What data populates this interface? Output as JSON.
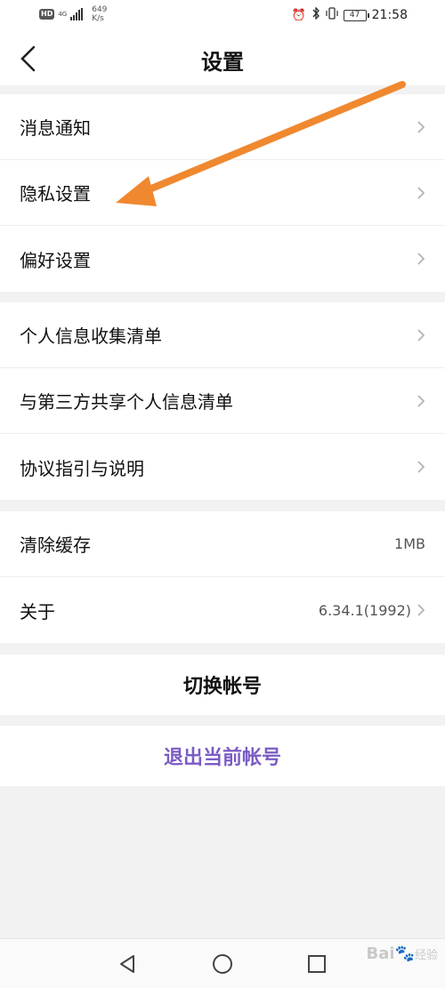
{
  "status_bar": {
    "hd": "HD",
    "network": "4G",
    "net_speed_value": "649",
    "net_speed_unit": "K/s",
    "battery": "47",
    "time": "21:58"
  },
  "header": {
    "title": "设置"
  },
  "groups": [
    {
      "items": [
        {
          "label": "消息通知"
        },
        {
          "label": "隐私设置"
        },
        {
          "label": "偏好设置"
        }
      ]
    },
    {
      "items": [
        {
          "label": "个人信息收集清单"
        },
        {
          "label": "与第三方共享个人信息清单"
        },
        {
          "label": "协议指引与说明"
        }
      ]
    },
    {
      "items": [
        {
          "label": "清除缓存",
          "value": "1MB"
        },
        {
          "label": "关于",
          "value": "6.34.1(1992)"
        }
      ]
    }
  ],
  "actions": {
    "switch_account": "切换帐号",
    "logout": "退出当前帐号"
  },
  "watermark": {
    "brand": "Bai",
    "suffix": "经验"
  },
  "colors": {
    "logout_text": "#7b5cc4",
    "annotation_arrow": "#f0882f",
    "chevron": "#b0b0b0"
  }
}
